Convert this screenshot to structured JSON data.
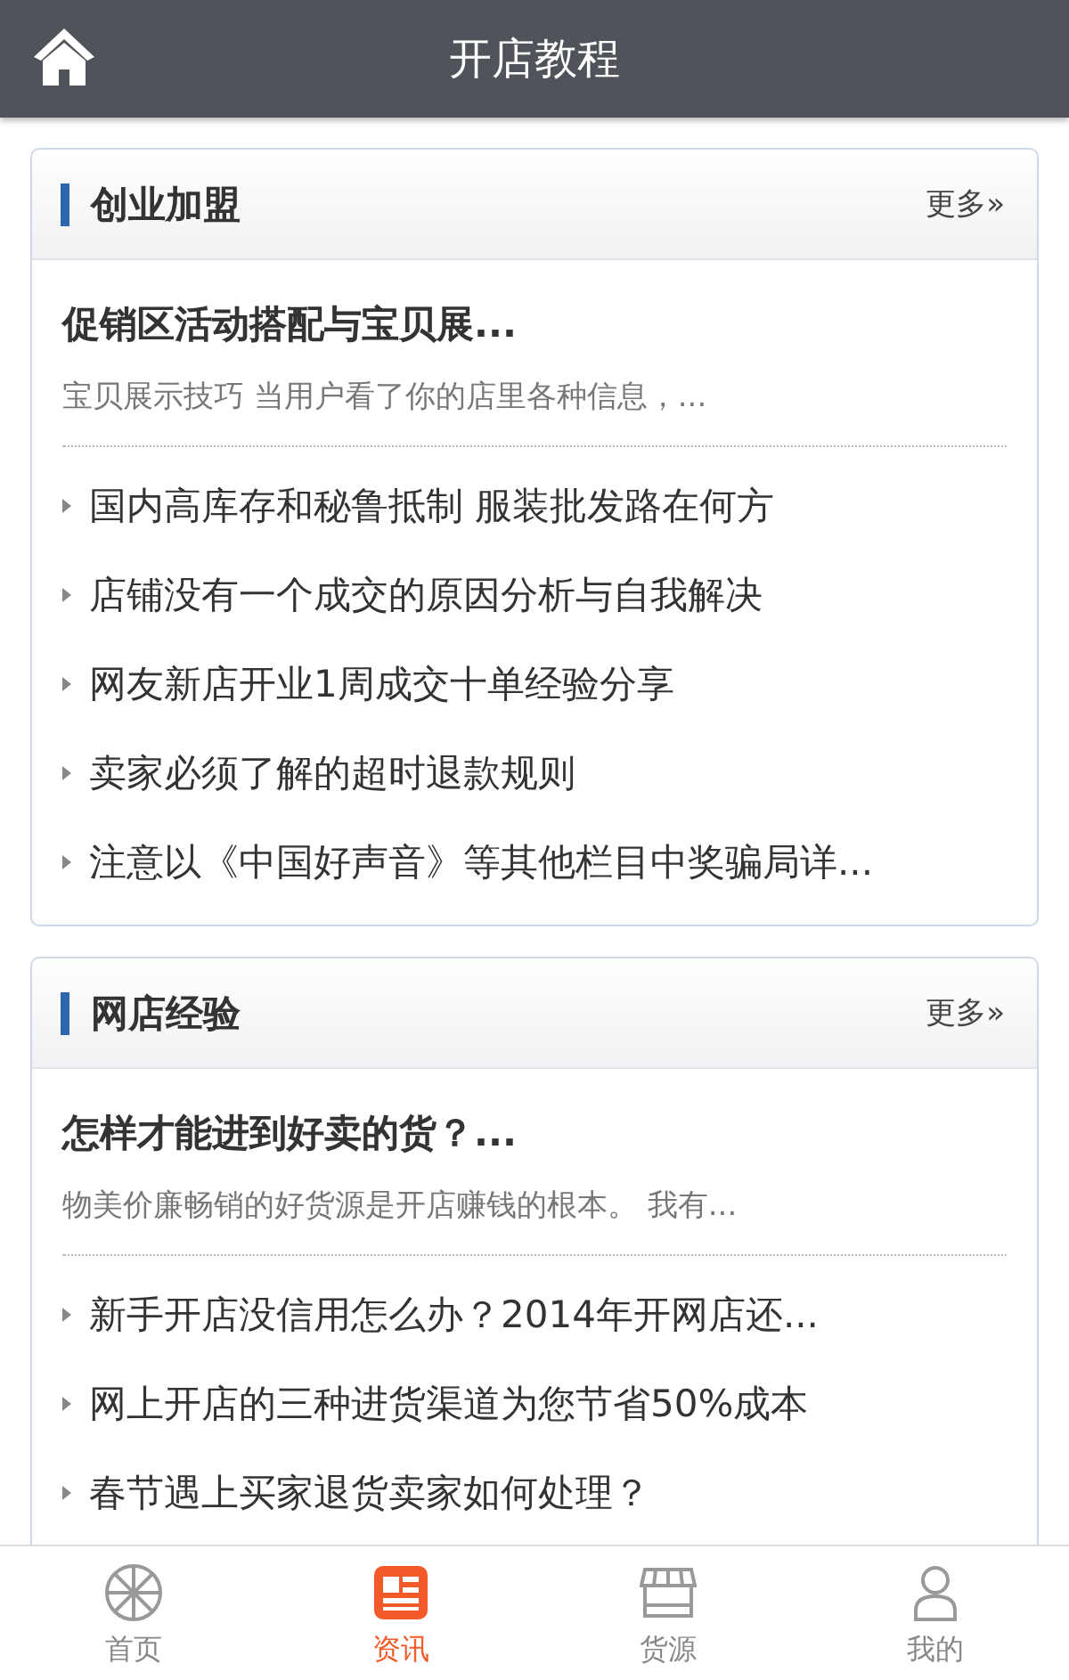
{
  "header": {
    "title": "开店教程"
  },
  "sections": [
    {
      "title": "创业加盟",
      "more": "更多»",
      "featured": {
        "title": "促销区活动搭配与宝贝展...",
        "summary": "宝贝展示技巧 当用户看了你的店里各种信息，..."
      },
      "items": [
        "国内高库存和秘鲁抵制 服装批发路在何方",
        "店铺没有一个成交的原因分析与自我解决",
        "网友新店开业1周成交十单经验分享",
        "卖家必须了解的超时退款规则",
        "注意以《中国好声音》等其他栏目中奖骗局详..."
      ]
    },
    {
      "title": "网店经验",
      "more": "更多»",
      "featured": {
        "title": "怎样才能进到好卖的货？...",
        "summary": "物美价廉畅销的好货源是开店赚钱的根本。 我有..."
      },
      "items": [
        "新手开店没信用怎么办？2014年开网店还...",
        "网上开店的三种进货渠道为您节省50%成本",
        "春节遇上买家退货卖家如何处理？"
      ]
    }
  ],
  "tabs": [
    {
      "label": "首页",
      "selected": false
    },
    {
      "label": "资讯",
      "selected": true
    },
    {
      "label": "货源",
      "selected": false
    },
    {
      "label": "我的",
      "selected": false
    }
  ]
}
